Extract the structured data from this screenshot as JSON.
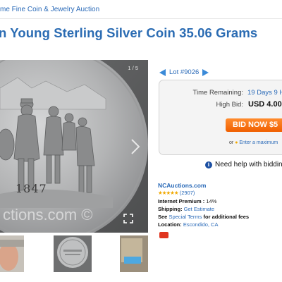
{
  "header": {
    "breadcrumb": "me Fine Coin & Jewelry Auction"
  },
  "listing": {
    "title": "n Young Sterling Silver Coin 35.06 Grams"
  },
  "gallery": {
    "counter": "1 / 5",
    "watermark": "ctions.com ©",
    "coin_year": "1847"
  },
  "lot": {
    "label": "Lot #9026"
  },
  "bid": {
    "time_label": "Time Remaining:",
    "time_value": "19 Days 9 H",
    "high_label": "High Bid:",
    "high_value": "USD 4.00",
    "button_label": "BID NOW $5",
    "max_prefix": "or",
    "max_link": "Enter a maximum"
  },
  "help": {
    "label": "Need help with bidding"
  },
  "seller": {
    "name": "NCAuctions.com",
    "stars": "★★★★★",
    "rating_count": "(2907)",
    "premium_label": "Internet Premium :",
    "premium_value": "14%",
    "shipping_label": "Shipping:",
    "shipping_link": "Get Estimate",
    "terms_label": "See",
    "terms_link": "Special Terms",
    "terms_suffix": "for additional fees",
    "location_label": "Location:",
    "location_value": "Escondido, CA"
  },
  "colors": {
    "link_blue": "#2a6ab8",
    "title_blue": "#2b6cb3",
    "bid_orange": "#f26a0a",
    "time_blue": "#2a6ab8",
    "star_gold": "#f0a800"
  }
}
